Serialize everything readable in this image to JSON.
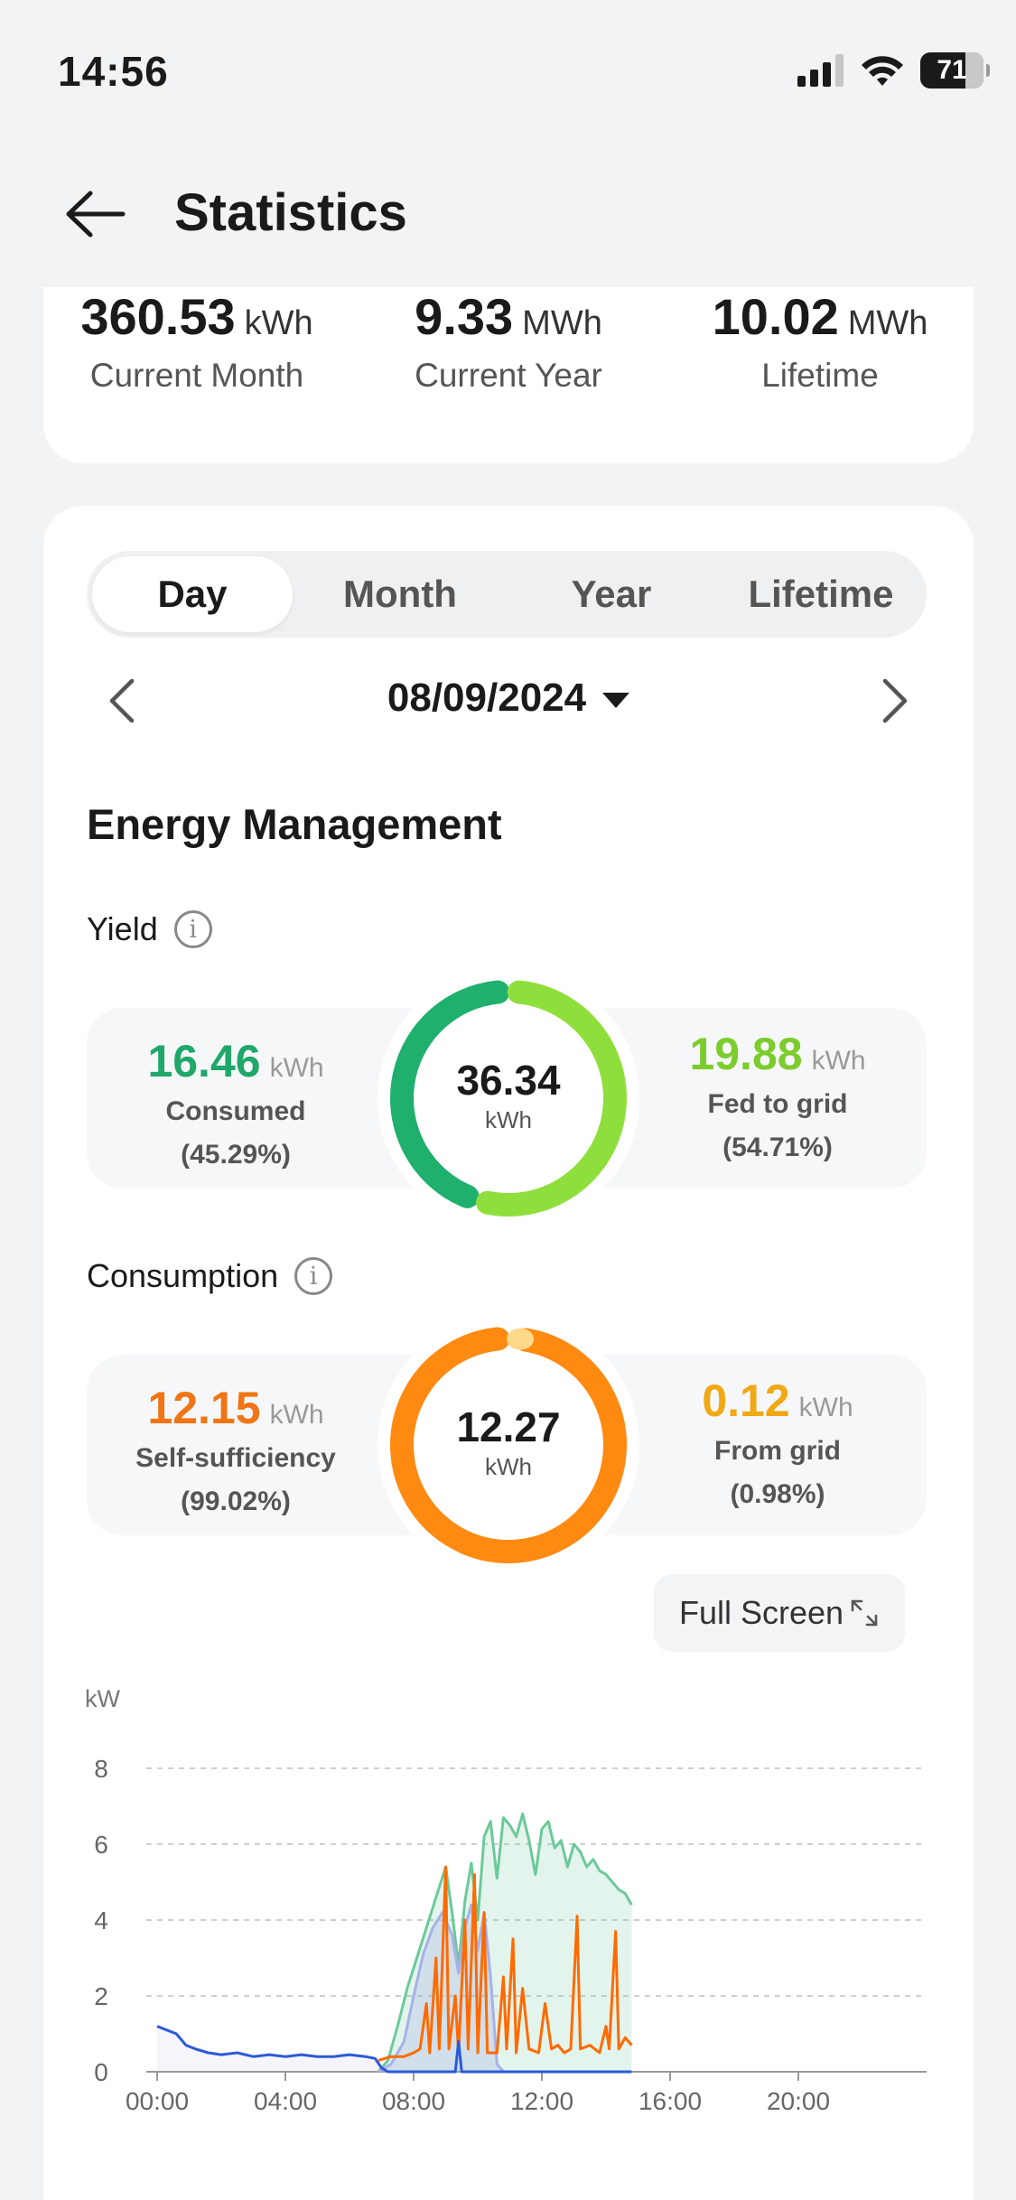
{
  "status_bar": {
    "time": "14:56",
    "battery": "71"
  },
  "header": {
    "title": "Statistics"
  },
  "summary": {
    "items": [
      {
        "value": "360.53",
        "unit": "kWh",
        "label": "Current Month"
      },
      {
        "value": "9.33",
        "unit": "MWh",
        "label": "Current Year"
      },
      {
        "value": "10.02",
        "unit": "MWh",
        "label": "Lifetime"
      }
    ]
  },
  "tabs": [
    {
      "label": "Day",
      "active": true
    },
    {
      "label": "Month"
    },
    {
      "label": "Year"
    },
    {
      "label": "Lifetime"
    }
  ],
  "date": "08/09/2024",
  "section_title": "Energy Management",
  "yield": {
    "title": "Yield",
    "total": "36.34",
    "total_unit": "kWh",
    "left": {
      "value": "16.46",
      "unit": "kWh",
      "label": "Consumed",
      "pct": "(45.29%)"
    },
    "right": {
      "value": "19.88",
      "unit": "kWh",
      "label": "Fed to grid",
      "pct": "(54.71%)"
    },
    "share_left": 0.4529,
    "colors": {
      "left": "#1fb06e",
      "right": "#8fdf3c"
    }
  },
  "consumption": {
    "title": "Consumption",
    "total": "12.27",
    "total_unit": "kWh",
    "left": {
      "value": "12.15",
      "unit": "kWh",
      "label": "Self-sufficiency",
      "pct": "(99.02%)"
    },
    "right": {
      "value": "0.12",
      "unit": "kWh",
      "label": "From grid",
      "pct": "(0.98%)"
    },
    "share_left": 0.9902,
    "colors": {
      "left": "#ff8a12",
      "right": "#ffd98a"
    }
  },
  "fullscreen_label": "Full Screen",
  "chart_data": {
    "type": "line",
    "ylabel": "kW",
    "ylim": [
      0,
      8
    ],
    "yticks": [
      "0",
      "2",
      "4",
      "6",
      "8"
    ],
    "xticks": [
      "00:00",
      "04:00",
      "08:00",
      "12:00",
      "16:00",
      "20:00"
    ],
    "grid": true,
    "series": [
      {
        "color": "#6cc99a",
        "points": [
          [
            6.9,
            0
          ],
          [
            7.2,
            0.3
          ],
          [
            7.5,
            1.2
          ],
          [
            7.8,
            2.2
          ],
          [
            8.1,
            3.0
          ],
          [
            8.4,
            3.8
          ],
          [
            8.7,
            4.6
          ],
          [
            9.0,
            5.4
          ],
          [
            9.2,
            4.2
          ],
          [
            9.4,
            2.8
          ],
          [
            9.6,
            4.5
          ],
          [
            9.8,
            5.5
          ],
          [
            10.0,
            4.0
          ],
          [
            10.2,
            6.2
          ],
          [
            10.4,
            6.6
          ],
          [
            10.6,
            5.1
          ],
          [
            10.8,
            6.7
          ],
          [
            11.0,
            6.5
          ],
          [
            11.2,
            6.2
          ],
          [
            11.4,
            6.8
          ],
          [
            11.6,
            6.1
          ],
          [
            11.8,
            5.2
          ],
          [
            12.0,
            6.4
          ],
          [
            12.2,
            6.6
          ],
          [
            12.4,
            5.9
          ],
          [
            12.6,
            6.1
          ],
          [
            12.8,
            5.4
          ],
          [
            13.0,
            6.0
          ],
          [
            13.2,
            5.8
          ],
          [
            13.4,
            5.4
          ],
          [
            13.6,
            5.6
          ],
          [
            13.8,
            5.3
          ],
          [
            14.0,
            5.2
          ],
          [
            14.2,
            5.0
          ],
          [
            14.4,
            4.8
          ],
          [
            14.6,
            4.7
          ],
          [
            14.8,
            4.4
          ]
        ]
      },
      {
        "color": "#a7b1e8",
        "points": [
          [
            6.9,
            0
          ],
          [
            7.3,
            0.2
          ],
          [
            7.7,
            0.8
          ],
          [
            8.0,
            2.0
          ],
          [
            8.3,
            3.1
          ],
          [
            8.6,
            3.8
          ],
          [
            8.9,
            4.2
          ],
          [
            9.2,
            3.6
          ],
          [
            9.4,
            2.6
          ],
          [
            9.6,
            3.8
          ],
          [
            9.8,
            4.4
          ],
          [
            10.0,
            3.2
          ],
          [
            10.2,
            4.2
          ],
          [
            10.4,
            2.5
          ],
          [
            10.6,
            0.2
          ],
          [
            10.8,
            0
          ]
        ]
      },
      {
        "color": "#ff6a00",
        "points": [
          [
            6.9,
            0.3
          ],
          [
            7.3,
            0.4
          ],
          [
            7.7,
            0.4
          ],
          [
            8.0,
            0.5
          ],
          [
            8.2,
            0.6
          ],
          [
            8.4,
            1.8
          ],
          [
            8.5,
            0.5
          ],
          [
            8.7,
            3.0
          ],
          [
            8.8,
            0.6
          ],
          [
            9.0,
            5.4
          ],
          [
            9.1,
            0.6
          ],
          [
            9.3,
            2.0
          ],
          [
            9.4,
            0.5
          ],
          [
            9.6,
            4.0
          ],
          [
            9.7,
            0.6
          ],
          [
            9.9,
            5.2
          ],
          [
            10.0,
            0.5
          ],
          [
            10.2,
            4.2
          ],
          [
            10.3,
            0.5
          ],
          [
            10.6,
            0.5
          ],
          [
            10.8,
            2.5
          ],
          [
            10.9,
            0.6
          ],
          [
            11.1,
            3.5
          ],
          [
            11.2,
            0.5
          ],
          [
            11.4,
            2.2
          ],
          [
            11.6,
            0.6
          ],
          [
            11.9,
            0.5
          ],
          [
            12.1,
            1.8
          ],
          [
            12.3,
            0.6
          ],
          [
            12.5,
            0.7
          ],
          [
            12.7,
            0.5
          ],
          [
            12.9,
            0.6
          ],
          [
            13.1,
            4.1
          ],
          [
            13.2,
            0.6
          ],
          [
            13.5,
            0.7
          ],
          [
            13.8,
            0.5
          ],
          [
            14.0,
            1.2
          ],
          [
            14.1,
            0.6
          ],
          [
            14.3,
            3.7
          ],
          [
            14.4,
            0.6
          ],
          [
            14.6,
            0.9
          ],
          [
            14.8,
            0.7
          ]
        ]
      },
      {
        "color": "#2b5ad8",
        "points": [
          [
            0,
            1.2
          ],
          [
            0.3,
            1.1
          ],
          [
            0.6,
            1.0
          ],
          [
            0.9,
            0.7
          ],
          [
            1.2,
            0.6
          ],
          [
            1.6,
            0.5
          ],
          [
            2.0,
            0.45
          ],
          [
            2.5,
            0.5
          ],
          [
            3.0,
            0.4
          ],
          [
            3.5,
            0.45
          ],
          [
            4.0,
            0.4
          ],
          [
            4.5,
            0.45
          ],
          [
            5.0,
            0.4
          ],
          [
            5.5,
            0.4
          ],
          [
            6.0,
            0.45
          ],
          [
            6.5,
            0.4
          ],
          [
            6.8,
            0.35
          ],
          [
            7.0,
            0.1
          ],
          [
            7.2,
            0
          ],
          [
            9.3,
            0
          ],
          [
            9.4,
            0.8
          ],
          [
            9.5,
            0
          ],
          [
            14.8,
            0
          ]
        ]
      }
    ]
  }
}
